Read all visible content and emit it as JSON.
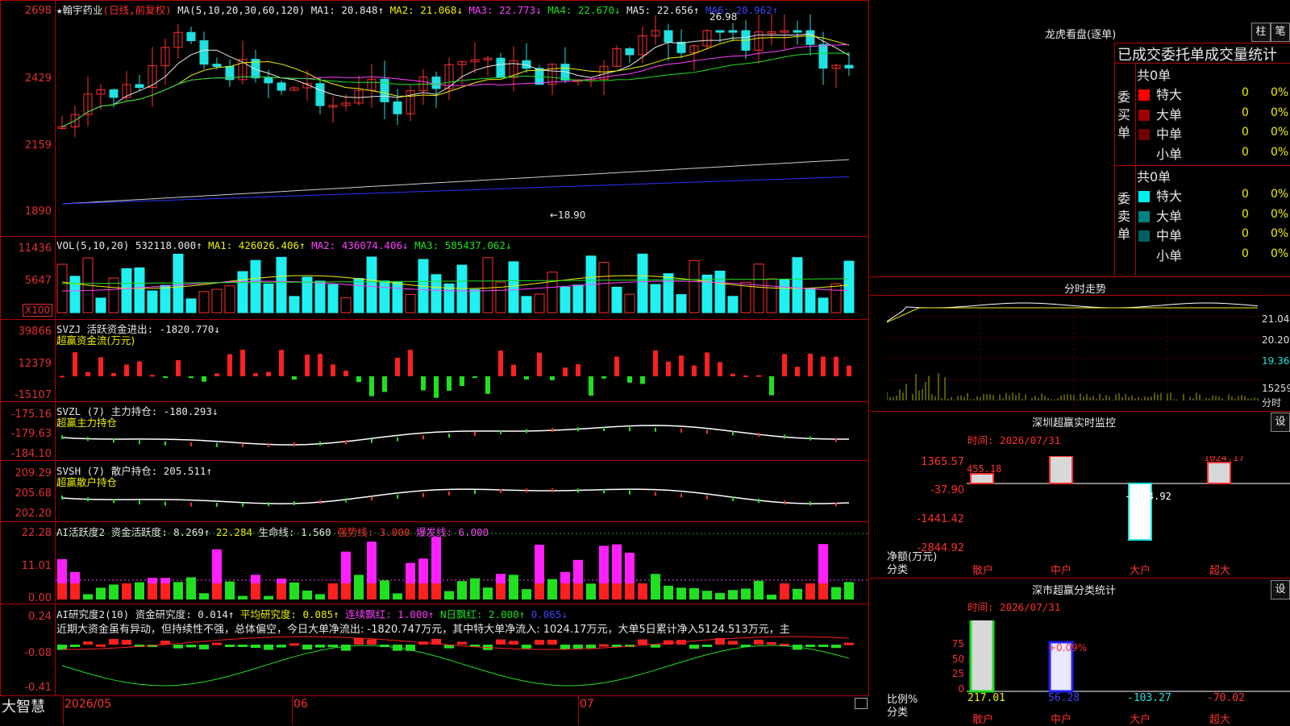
{
  "stock": {
    "star": "★",
    "name": "翰宇药业",
    "period": "(日线,前复权)"
  },
  "kline": {
    "ma_header": "MA(5,10,20,30,60,120)",
    "ma1": "MA1: 20.848↑",
    "ma2": "MA2: 21.068↓",
    "ma3": "MA3: 22.773↓",
    "ma4": "MA4: 22.670↓",
    "ma5": "MA5: 22.656↑",
    "ma6": "MA6: 20.962↑",
    "y_ticks": [
      "2698",
      "2429",
      "2159",
      "1890"
    ],
    "high_marker": "26.98",
    "low_marker": "←18.90"
  },
  "vol": {
    "header": "VOL(5,10,20)",
    "value": "532118.000↑",
    "ma1": "MA1: 426026.406↑",
    "ma2": "MA2: 436074.406↓",
    "ma3": "MA3: 585437.062↓",
    "y_ticks": [
      "11436",
      "5647"
    ],
    "unit": "X100"
  },
  "svzj": {
    "header": "SVZJ  活跃资金进出: -1820.770↓",
    "subtitle": "超赢资金流(万元)",
    "y_ticks": [
      "39866",
      "12379",
      "-15107"
    ]
  },
  "svzl": {
    "header": "SVZL (7) 主力持仓: -180.293↓",
    "subtitle": "超赢主力持仓",
    "y_ticks": [
      "-175.16",
      "-179.63",
      "-184.10"
    ]
  },
  "svsh": {
    "header": "SVSH (7) 散户持仓: 205.511↑",
    "subtitle": "超赢散户持仓",
    "y_ticks": [
      "209.29",
      "205.68",
      "202.20"
    ]
  },
  "ai1": {
    "header": "AI活跃度2 资金活跃度: 8.269↑",
    "v2": "22.284",
    "life": "生命线: 1.560",
    "strong": "强势线: 3.000",
    "burst": "爆发线: 6.000",
    "y_ticks": [
      "22.28",
      "11.01",
      "0.00"
    ]
  },
  "ai2": {
    "header": "AI研究度2(10) 资金研究度: 0.014↑",
    "avg": "平均研究度: 0.085↑",
    "lianxu": "连续飘红: 1.000↑",
    "nri": "N日飘红: 2.000↑",
    "last": "0.065↓",
    "desc": "近期大资金虽有异动，但持续性不强，总体偏空，今日大单净流出: -1820.747万元，其中特大单净流入: 1024.17万元，大单5日累计净入5124.513万元，主",
    "y_ticks": [
      "0.24",
      "-0.08",
      "-0.41"
    ]
  },
  "bottom": {
    "logo": "大智慧",
    "dates": [
      "2026/05",
      "06",
      "07"
    ]
  },
  "right": {
    "title": "龙虎看盘(逐单)",
    "btn1": "柱",
    "btn2": "笔",
    "table_header": "已成交委托单成交量统计",
    "buy_side": "委买单",
    "sell_side": "委卖单",
    "buy_total": "共0单",
    "sell_total": "共0单",
    "rows_buy": [
      {
        "label": "特大",
        "n": "0",
        "p": "0%",
        "color": "#ff0000"
      },
      {
        "label": "大单",
        "n": "0",
        "p": "0%",
        "color": "#a00000"
      },
      {
        "label": "中单",
        "n": "0",
        "p": "0%",
        "color": "#700000"
      },
      {
        "label": "小单",
        "n": "0",
        "p": "0%",
        "color": "#000"
      }
    ],
    "rows_sell": [
      {
        "label": "特大",
        "n": "0",
        "p": "0%",
        "color": "#00f0f0"
      },
      {
        "label": "大单",
        "n": "0",
        "p": "0%",
        "color": "#008080"
      },
      {
        "label": "中单",
        "n": "0",
        "p": "0%",
        "color": "#006060"
      },
      {
        "label": "小单",
        "n": "0",
        "p": "0%",
        "color": "#000"
      }
    ],
    "intraday_title": "分时走势",
    "intraday_labels": [
      "21.04",
      "20.20",
      "19.36",
      "15259",
      "分时"
    ],
    "monitor_title": "深圳超赢实时监控",
    "settings": "设",
    "monitor_time": "时间: 2026/07/31",
    "monitor_y": [
      "1365.57",
      "-37.90",
      "-1441.42",
      "-2844.92"
    ],
    "monitor_vals": [
      "455.18",
      "1365.57",
      "-2844.92",
      "1024.17"
    ],
    "net_label": "净额(万元)",
    "class_label": "分类",
    "cats": [
      "散户",
      "中户",
      "大户",
      "超大"
    ],
    "stats_title": "深市超赢分类统计",
    "stats_time": "时间: 2026/07/31",
    "stats_y": [
      "75",
      "50",
      "25",
      "0"
    ],
    "stats_pct": "+0.09%",
    "stats_vals": [
      "217.01",
      "56.28",
      "-103.27",
      "-70.02"
    ],
    "ratio_label": "比例%"
  }
}
